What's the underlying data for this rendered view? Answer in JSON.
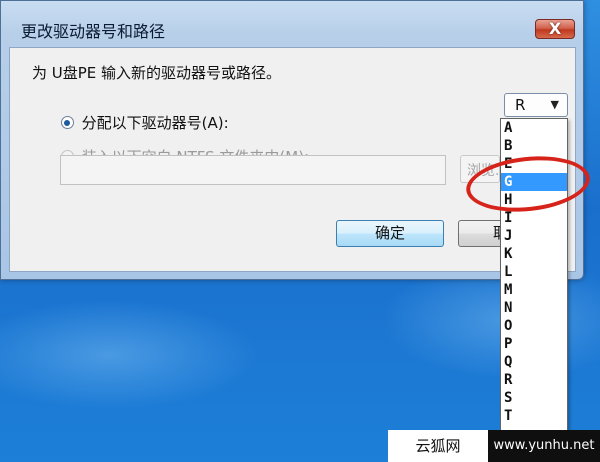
{
  "window": {
    "title": "更改驱动器号和路径",
    "close_label": "X"
  },
  "dialog": {
    "prompt": "为 U盘PE 输入新的驱动器号或路径。",
    "option_assign": "分配以下驱动器号(A):",
    "option_mount": "装入以下空白 NTFS 文件夹中(M):",
    "drive_value": "R",
    "path_value": "",
    "browse_label": "浏览...",
    "ok_label": "确定",
    "cancel_label": "取消"
  },
  "dropdown": {
    "items": [
      "A",
      "B",
      "E",
      "G",
      "H",
      "I",
      "J",
      "K",
      "L",
      "M",
      "N",
      "O",
      "P",
      "Q",
      "R",
      "S",
      "T"
    ],
    "selected": "G"
  },
  "watermark": {
    "left": "云狐网",
    "right": "www.yunhu.net"
  },
  "colors": {
    "selection": "#3399ff",
    "highlight_circle": "#d6241b",
    "desktop": "#1a6fcc"
  }
}
